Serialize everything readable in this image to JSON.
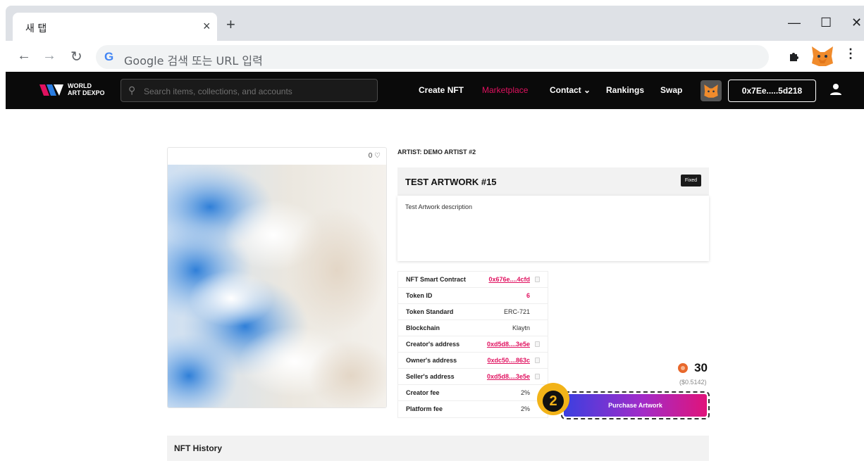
{
  "browser": {
    "tab_title": "새 탭",
    "tab_close": "×",
    "new_tab": "+",
    "minimize": "—",
    "maximize": "☐",
    "close": "✕",
    "omnibox_placeholder": "Google 검색 또는 URL 입력",
    "icons": [
      "back-icon",
      "forward-icon",
      "reload-icon",
      "google-icon",
      "extensions-icon",
      "metamask-icon",
      "menu-icon"
    ]
  },
  "site": {
    "logo_line1": "WORLD",
    "logo_line2": "ART DEXPO",
    "search_placeholder": "Search items, collections, and accounts",
    "nav": {
      "create": "Create NFT",
      "marketplace": "Marketplace",
      "contact": "Contact ⌄",
      "rankings": "Rankings",
      "swap": "Swap"
    },
    "wallet": "0x7Ee.....5d218",
    "accent_color": "#e0115f"
  },
  "artwork": {
    "likes": "0 ♡",
    "artist": "ARTIST: DEMO ARTIST #2",
    "title": "TEST ARTWORK #15",
    "badge": "Fixed",
    "description": "Test Artwork description",
    "details": [
      {
        "key": "NFT Smart Contract",
        "value": "0x676e....4cfd",
        "style": "link",
        "copy": true
      },
      {
        "key": "Token ID",
        "value": "6",
        "style": "red",
        "copy": false
      },
      {
        "key": "Token Standard",
        "value": "ERC-721",
        "style": "plain",
        "copy": false
      },
      {
        "key": "Blockchain",
        "value": "Klaytn",
        "style": "plain",
        "copy": false
      },
      {
        "key": "Creator's address",
        "value": "0xd5d8....3e5e",
        "style": "link",
        "copy": true
      },
      {
        "key": "Owner's address",
        "value": "0xdc50....863c",
        "style": "link",
        "copy": true
      },
      {
        "key": "Seller's address",
        "value": "0xd5d8....3e5e",
        "style": "link",
        "copy": true
      },
      {
        "key": "Creator fee",
        "value": "2%",
        "style": "plain",
        "copy": false
      },
      {
        "key": "Platform fee",
        "value": "2%",
        "style": "plain",
        "copy": false
      }
    ],
    "price": "30",
    "price_usd": "($0.5142)",
    "purchase_label": "Purchase Artwork",
    "step_number": "2",
    "history_title": "NFT History"
  }
}
